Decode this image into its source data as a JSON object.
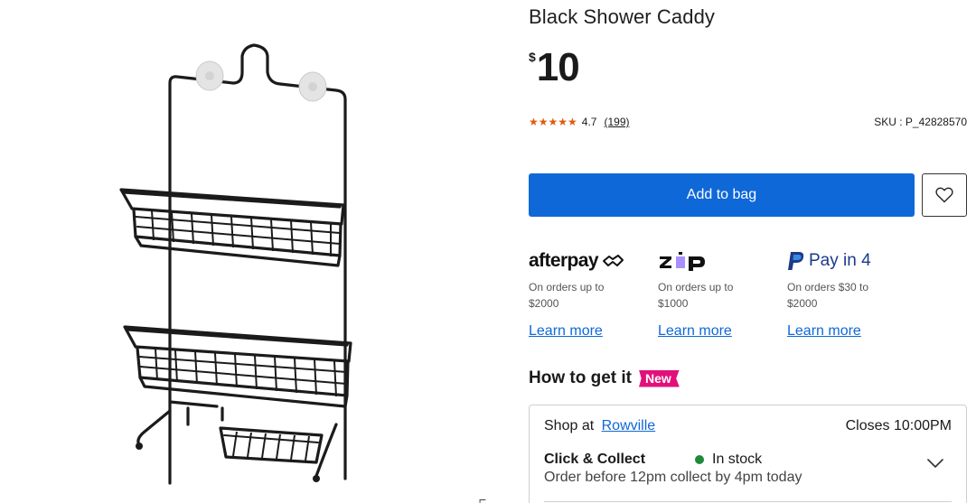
{
  "product": {
    "title": "Black Shower Caddy",
    "currency": "$",
    "price": "10",
    "rating_stars": 5,
    "rating_value": "4.7",
    "review_count": "(199)",
    "sku": "SKU : P_42828570"
  },
  "actions": {
    "add_to_bag": "Add to bag",
    "wishlist_icon": "heart-icon"
  },
  "payments": [
    {
      "brand": "afterpay",
      "note": "On orders up to $2000",
      "link": "Learn more"
    },
    {
      "brand": "zip",
      "note": "On orders up to $1000",
      "link": "Learn more"
    },
    {
      "brand": "Pay in 4",
      "note": "On orders $30 to $2000",
      "link": "Learn more"
    }
  ],
  "fulfilment": {
    "heading": "How to get it",
    "badge": "New",
    "shop_at_label": "Shop at",
    "store": "Rowville",
    "closes": "Closes 10:00PM",
    "click_collect_title": "Click & Collect",
    "stock_status": "In stock",
    "click_collect_note": "Order before 12pm collect by 4pm today"
  },
  "colors": {
    "primary": "#0f68d8",
    "star": "#e05c0d",
    "badge": "#e2107b",
    "in_stock": "#1f8a3b"
  }
}
